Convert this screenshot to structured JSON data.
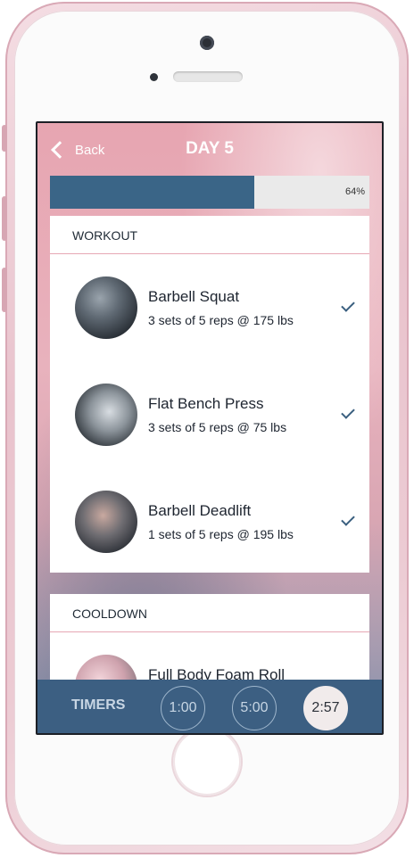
{
  "nav": {
    "back_label": "Back",
    "title": "DAY 5"
  },
  "progress": {
    "value": 0.64,
    "label": "64%"
  },
  "workout": {
    "header": "WORKOUT",
    "exercises": [
      {
        "name": "Barbell Squat",
        "detail": "3 sets of 5 reps @ 175 lbs",
        "completed": true,
        "photo": "barbell-squat-photo"
      },
      {
        "name": "Flat Bench Press",
        "detail": "3 sets of 5 reps @ 75 lbs",
        "completed": true,
        "photo": "bench-press-photo"
      },
      {
        "name": "Barbell Deadlift",
        "detail": "1 sets of 5 reps @ 195 lbs",
        "completed": true,
        "photo": "deadlift-photo"
      }
    ]
  },
  "cooldown": {
    "header": "COOLDOWN",
    "exercises": [
      {
        "name": "Full Body Foam Roll",
        "photo": "foam-roll-photo"
      }
    ]
  },
  "timers": {
    "label": "TIMERS",
    "options": [
      "1:00",
      "5:00",
      "2:57"
    ],
    "active": "2:57"
  },
  "colors": {
    "accent": "#3c5f82",
    "progress_fill": "#3a6587",
    "divider": "#e6a7b4"
  }
}
